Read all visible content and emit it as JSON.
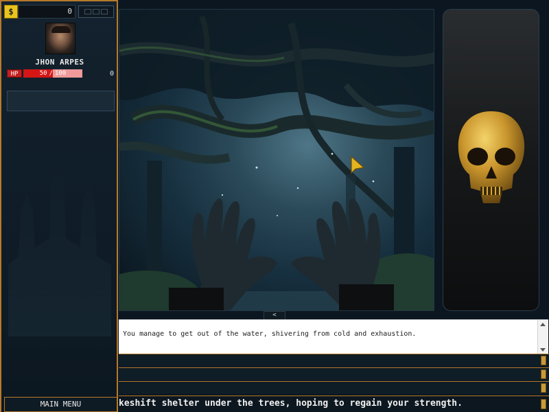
{
  "player": {
    "gold_symbol": "$",
    "gold": "0",
    "name": "JHON ARPES",
    "hp_label": "HP",
    "hp_current": "50",
    "hp_separator": "/",
    "hp_max": "100",
    "hp_fraction": 0.5,
    "secondary_value": "0"
  },
  "menu": {
    "main_menu_label": "MAIN MENU"
  },
  "scene": {
    "collapse_symbol": "<",
    "artifact_icon": "golden-skull-icon"
  },
  "log": {
    "line": "You manage to get out of the water, shivering from cold and exhaustion."
  },
  "choices": [
    "",
    "",
    ""
  ],
  "narration": "keshift shelter under the trees, hoping to regain your strength.",
  "colors": {
    "accent_border": "#b97a2a",
    "hp_fill": "#d41616",
    "hp_empty": "#f09a9a",
    "gold": "#e8c21e",
    "handle": "#c99a3a"
  }
}
